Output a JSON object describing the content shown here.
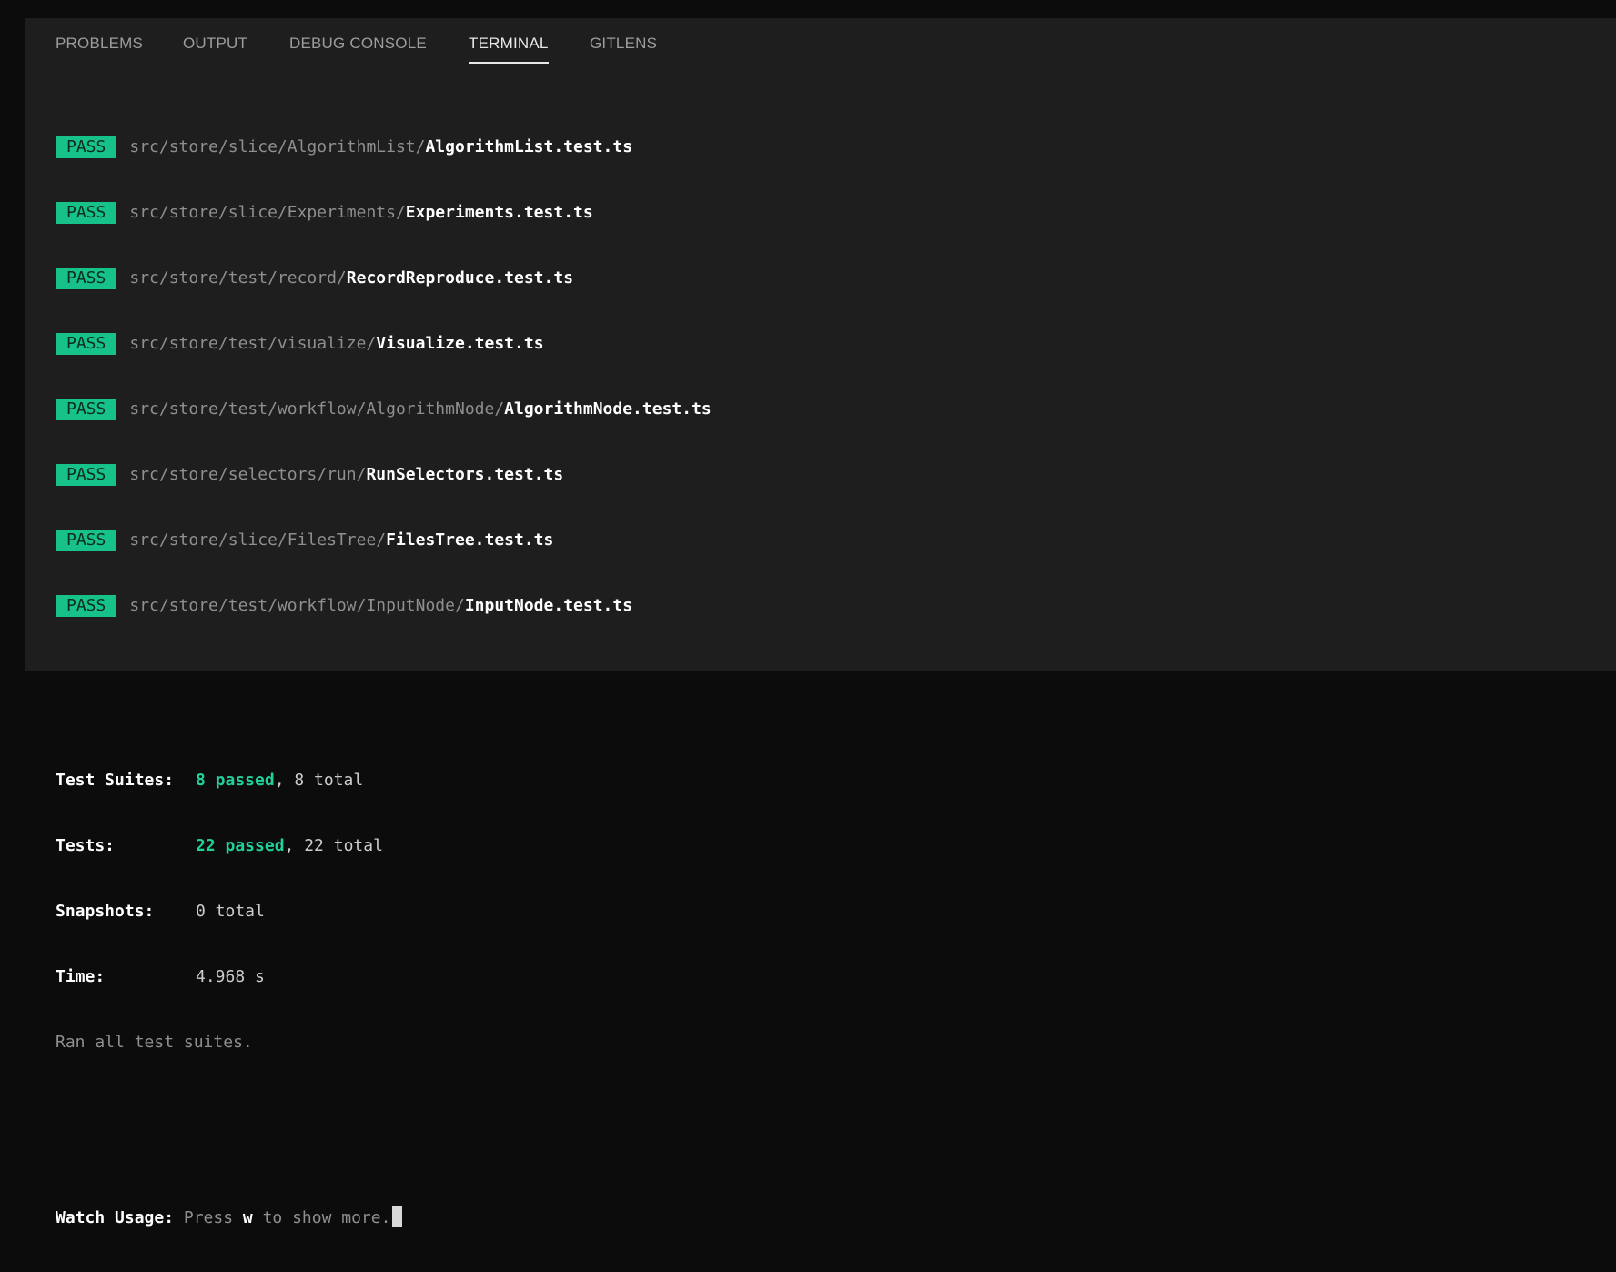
{
  "tabs": [
    {
      "label": "PROBLEMS",
      "active": false
    },
    {
      "label": "OUTPUT",
      "active": false
    },
    {
      "label": "DEBUG CONSOLE",
      "active": false
    },
    {
      "label": "TERMINAL",
      "active": true
    },
    {
      "label": "GITLENS",
      "active": false
    }
  ],
  "tests": [
    {
      "status": "PASS",
      "dir": "src/store/slice/AlgorithmList/",
      "file": "AlgorithmList.test.ts"
    },
    {
      "status": "PASS",
      "dir": "src/store/slice/Experiments/",
      "file": "Experiments.test.ts"
    },
    {
      "status": "PASS",
      "dir": "src/store/test/record/",
      "file": "RecordReproduce.test.ts"
    },
    {
      "status": "PASS",
      "dir": "src/store/test/visualize/",
      "file": "Visualize.test.ts"
    },
    {
      "status": "PASS",
      "dir": "src/store/test/workflow/AlgorithmNode/",
      "file": "AlgorithmNode.test.ts"
    },
    {
      "status": "PASS",
      "dir": "src/store/selectors/run/",
      "file": "RunSelectors.test.ts"
    },
    {
      "status": "PASS",
      "dir": "src/store/slice/FilesTree/",
      "file": "FilesTree.test.ts"
    },
    {
      "status": "PASS",
      "dir": "src/store/test/workflow/InputNode/",
      "file": "InputNode.test.ts"
    }
  ],
  "summary": {
    "suites_label": "Test Suites:",
    "suites_passed": "8 passed",
    "suites_total": ", 8 total",
    "tests_label": "Tests:",
    "tests_passed": "22 passed",
    "tests_total": ", 22 total",
    "snapshots_label": "Snapshots:",
    "snapshots_value": "0 total",
    "time_label": "Time:",
    "time_value": "4.968 s",
    "ran_all": "Ran all test suites."
  },
  "watch": {
    "label": "Watch Usage:",
    "pre": " Press ",
    "key": "w",
    "post": " to show more."
  },
  "colors": {
    "pass_badge": "#16c28a",
    "passed_text": "#1fd19a",
    "background": "#1e1e1e"
  }
}
